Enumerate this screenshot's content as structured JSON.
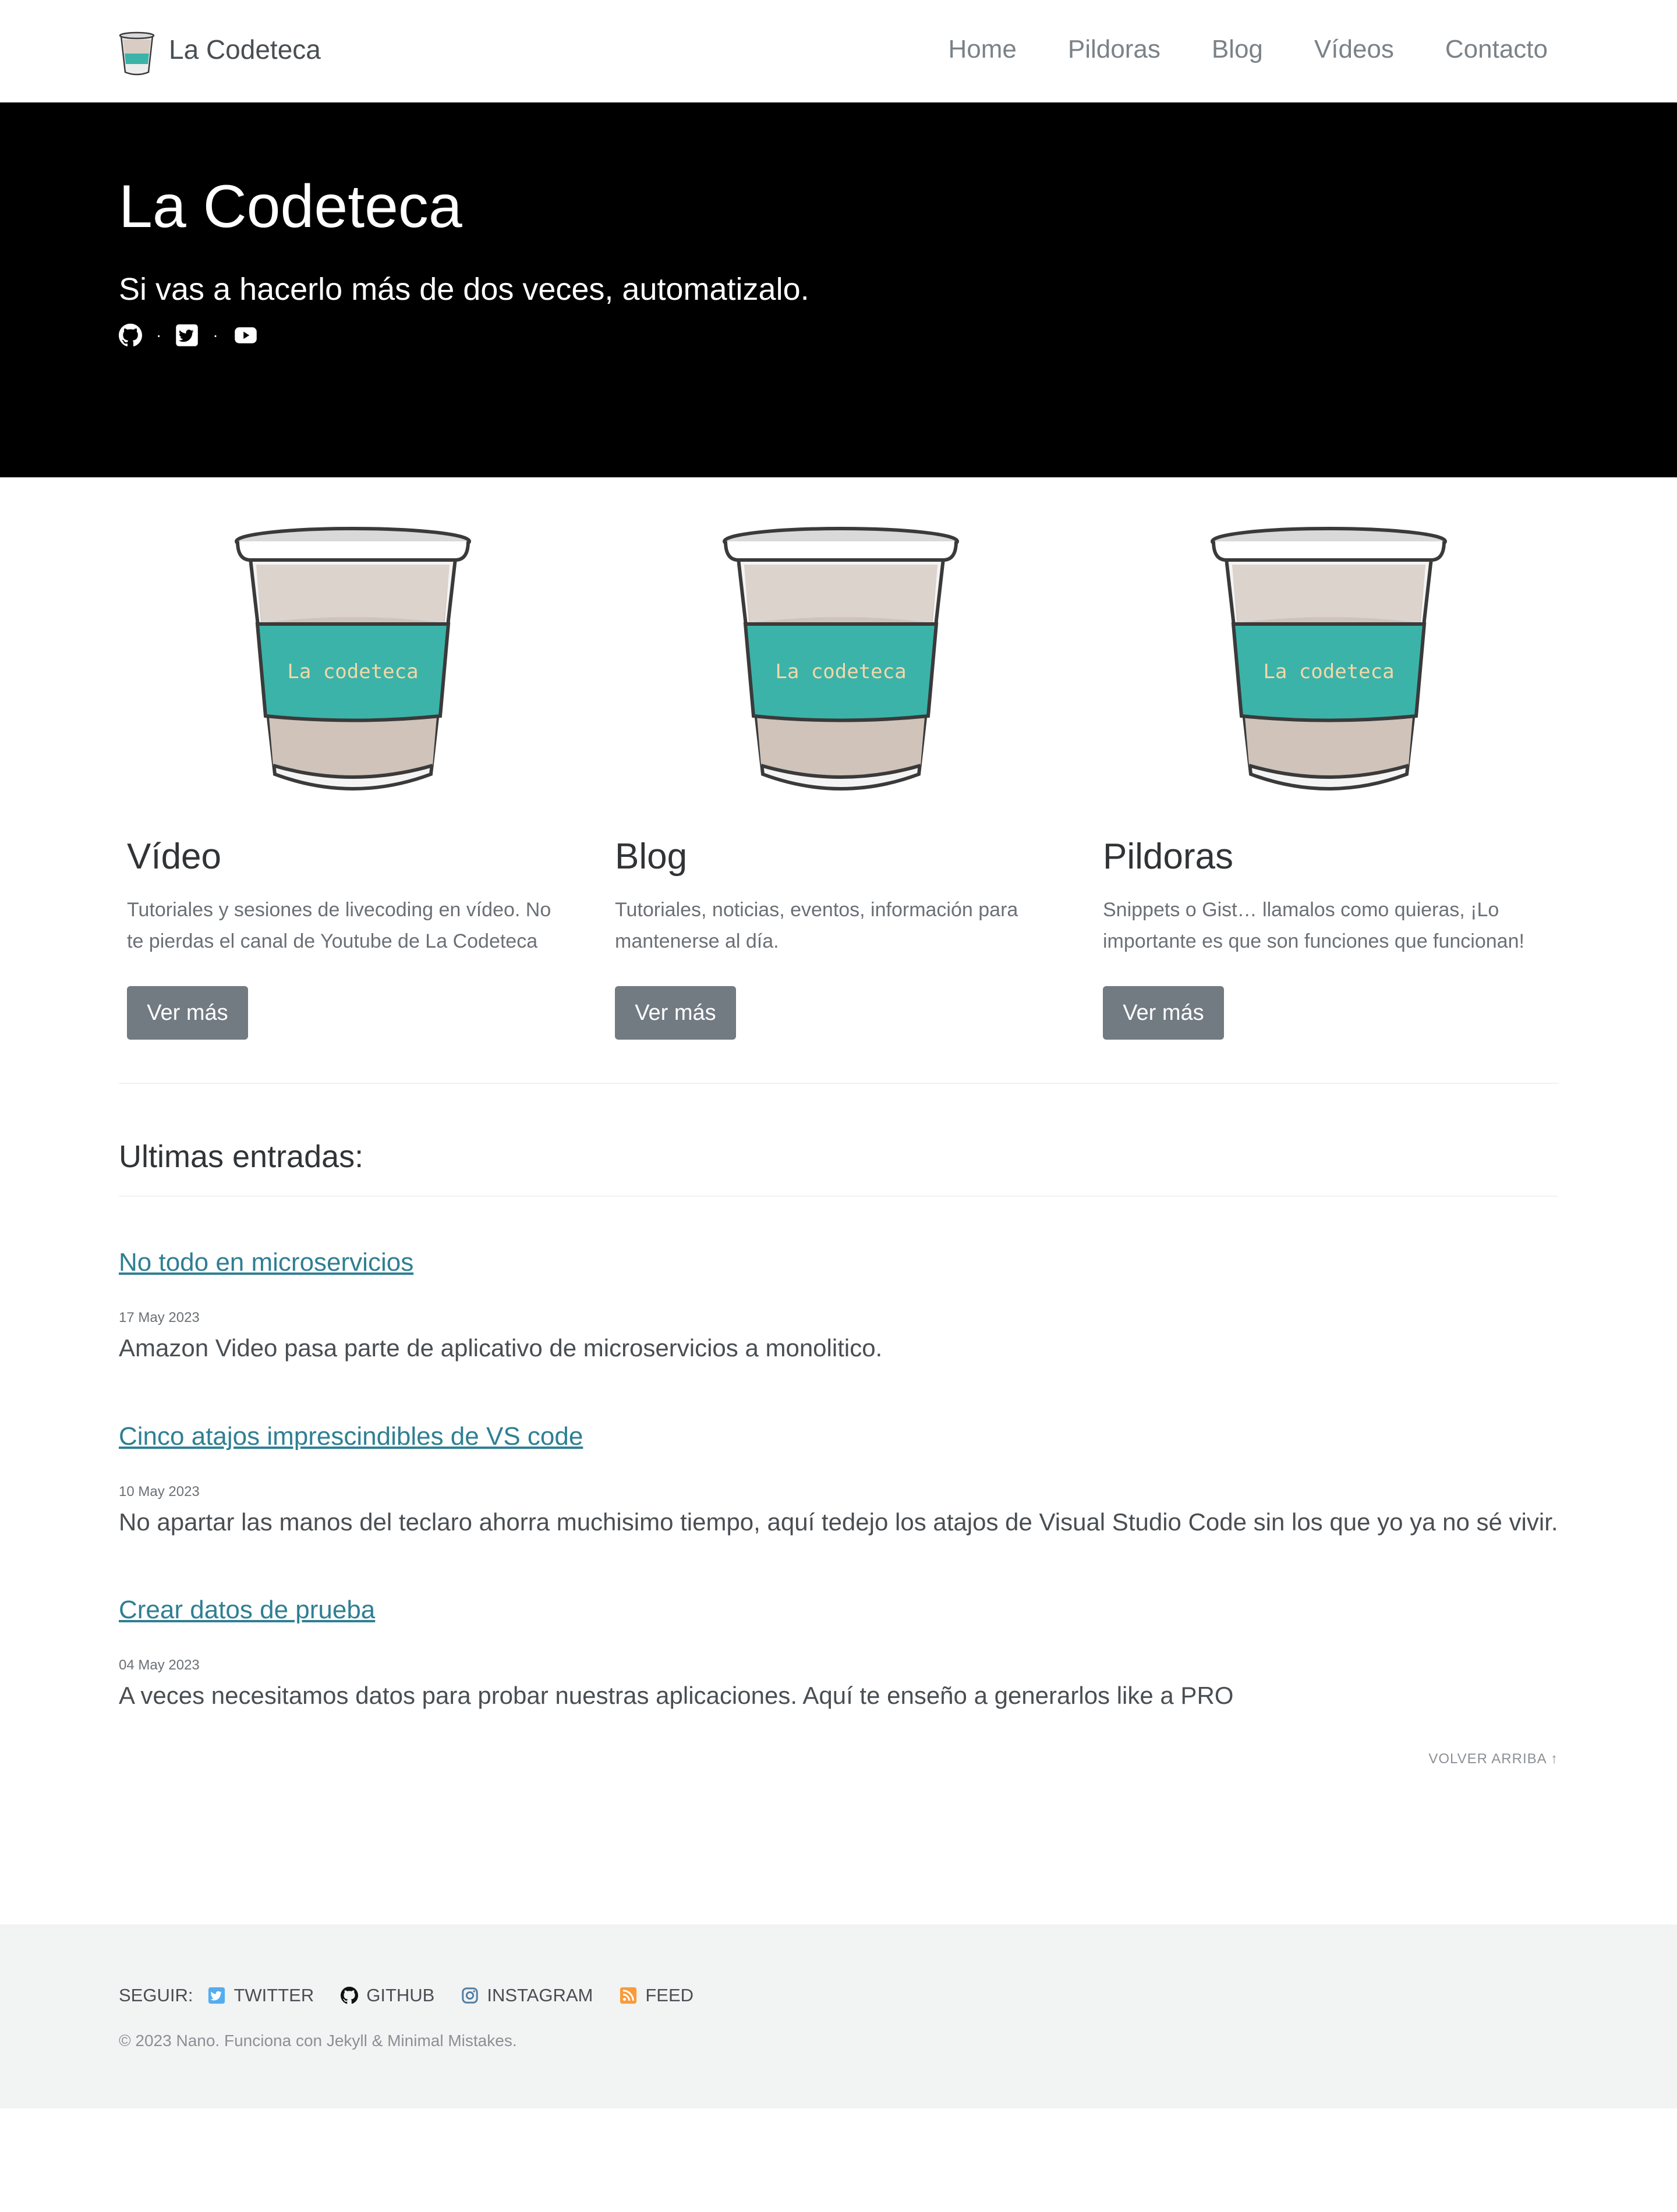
{
  "header": {
    "site_title": "La Codeteca",
    "nav": [
      "Home",
      "Pildoras",
      "Blog",
      "Vídeos",
      "Contacto"
    ]
  },
  "hero": {
    "title": "La Codeteca",
    "tagline": "Si vas a hacerlo más de dos veces, automatizalo.",
    "separator": "·",
    "icons": [
      "github-icon",
      "twitter-icon",
      "youtube-icon"
    ]
  },
  "features": [
    {
      "title": "Vídeo",
      "description": "Tutoriales y sesiones de livecoding en vídeo. No te pierdas el canal de Youtube de La Codeteca",
      "button": "Ver más",
      "cup_label": "La codeteca"
    },
    {
      "title": "Blog",
      "description": "Tutoriales, noticias, eventos, información para mantenerse al día.",
      "button": "Ver más",
      "cup_label": "La codeteca"
    },
    {
      "title": "Pildoras",
      "description": "Snippets o Gist… llamalos como quieras, ¡Lo importante es que son funciones que funcionan!",
      "button": "Ver más",
      "cup_label": "La codeteca"
    }
  ],
  "recent": {
    "title": "Ultimas entradas:",
    "posts": [
      {
        "title": "No todo en microservicios",
        "date": "17 May 2023",
        "excerpt": "Amazon Video pasa parte de aplicativo de microservicios a monolitico."
      },
      {
        "title": "Cinco atajos imprescindibles de VS code",
        "date": "10 May 2023",
        "excerpt": "No apartar las manos del teclaro ahorra muchisimo tiempo, aquí tedejo los atajos de Visual Studio Code sin los que yo ya no sé vivir."
      },
      {
        "title": "Crear datos de prueba",
        "date": "04 May 2023",
        "excerpt": "A veces necesitamos datos para probar nuestras aplicaciones. Aquí te enseño a generarlos like a PRO"
      }
    ],
    "back_to_top": "VOLVER ARRIBA ↑"
  },
  "footer": {
    "follow_label": "SEGUIR:",
    "links": [
      "TWITTER",
      "GITHUB",
      "INSTAGRAM",
      "FEED"
    ],
    "copyright": "© 2023 Nano. Funciona con Jekyll & Minimal Mistakes."
  },
  "colors": {
    "link": "#2f7f93",
    "button": "#727a82",
    "cup_band": "#3bb3a9",
    "cup_label": "#f4d7a8",
    "twitter": "#55acee",
    "feed": "#fa9b39"
  }
}
